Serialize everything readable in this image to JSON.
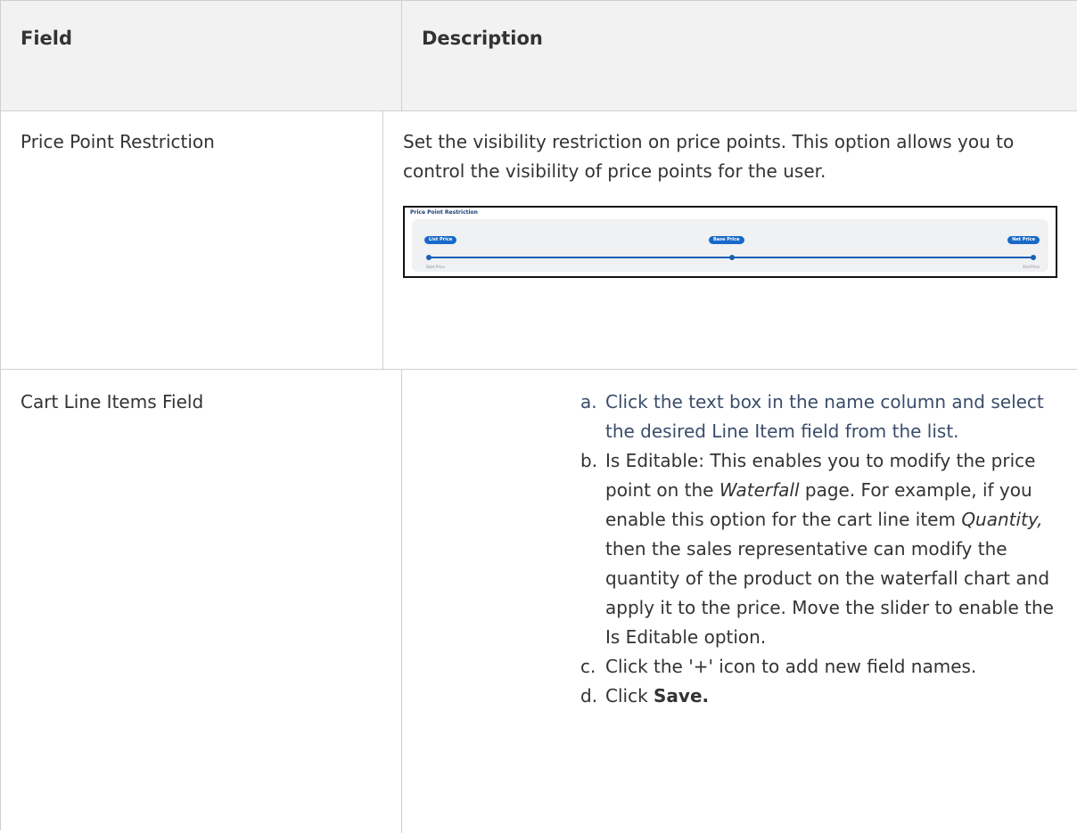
{
  "table": {
    "headers": {
      "field": "Field",
      "description": "Description"
    },
    "rows": [
      {
        "field": "Price Point Restriction",
        "description": "Set the visibility restriction on price points. This option allows you to control the visibility of price points for the user.",
        "image": {
          "title": "Price Point Restriction",
          "pills": [
            "List Price",
            "Base Price",
            "Net Price"
          ],
          "start_label": "Start Price",
          "end_label": "End Price",
          "accent_color": "#1769c9"
        }
      },
      {
        "field": "Cart Line Items Field",
        "steps": [
          {
            "marker": "a.",
            "text": "Click the text box in the name column and select the desired Line Item field from the list."
          },
          {
            "marker": "b.",
            "part1": "Is Editable: This enables you to modify the price point on the ",
            "em1": "Waterfall",
            "part2": " page. For example, if you enable this option for the cart line item ",
            "em2": "Quantity,",
            "part3": " then the sales representative can modify the quantity of the product on the waterfall chart and apply it to the price. Move the slider to enable the Is Editable option."
          },
          {
            "marker": "c.",
            "text": "Click the '+' icon to add new field names."
          },
          {
            "marker": "d.",
            "prefix": "Click ",
            "strong": "Save."
          }
        ]
      }
    ]
  }
}
